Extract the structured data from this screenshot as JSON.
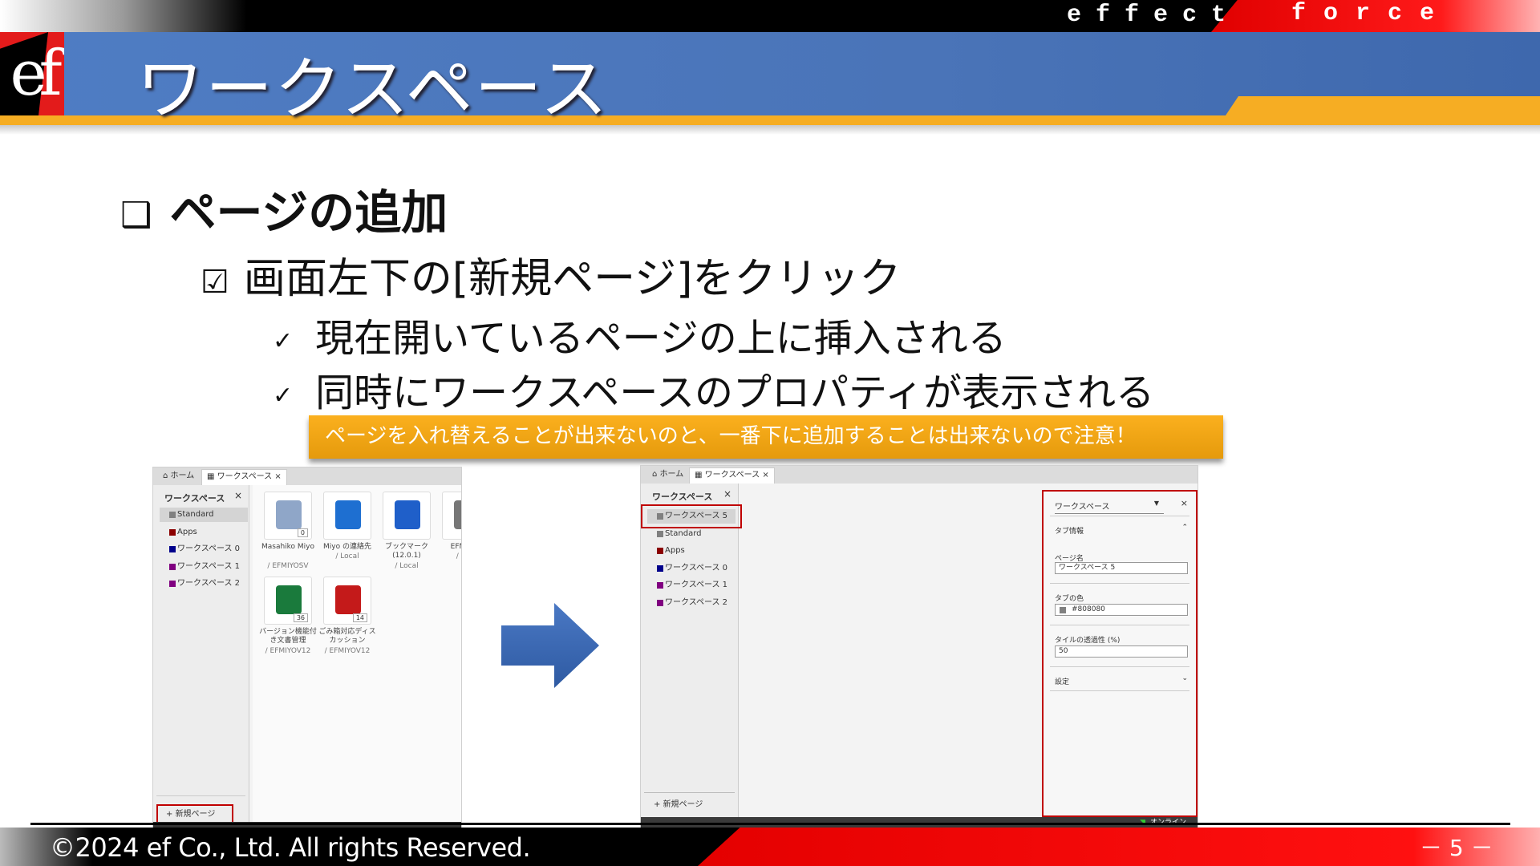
{
  "brand": {
    "left": "effect",
    "right": "force",
    "logo": "ef"
  },
  "slide": {
    "title": "ワークスペース",
    "heading": "ページの追加",
    "heading_marker": "❑",
    "step": "画面左下の[新規ページ]をクリック",
    "step_marker": "☑",
    "bullets": [
      "現在開いているページの上に挿入される",
      "同時にワークスペースのプロパティが表示される"
    ],
    "bullet_marker": "✓",
    "callout": "ページを入れ替えることが出来ないのと、一番下に追加することは出来ないので注意！"
  },
  "left_shot": {
    "tabs": [
      "ホーム",
      "ワークスペース"
    ],
    "panel_title": "ワークスペース",
    "items": [
      {
        "label": "Standard",
        "color": "#808080"
      },
      {
        "label": "Apps",
        "color": "#8b0000"
      },
      {
        "label": "ワークスペース 0",
        "color": "#00008b"
      },
      {
        "label": "ワークスペース 1",
        "color": "#800080"
      },
      {
        "label": "ワークスペース 2",
        "color": "#800080"
      }
    ],
    "tiles": [
      {
        "name": "Masahiko Miyo",
        "sub": "/ EFMIYOSV",
        "badge": "0",
        "color": "#8fa6c8"
      },
      {
        "name": "Miyo の連絡先",
        "sub": "/ Local",
        "badge": "",
        "color": "#1e6fd1"
      },
      {
        "name": "ブックマーク (12.0.1)",
        "sub": "/ Local",
        "badge": "",
        "color": "#1f5fc9"
      },
      {
        "name": "EFMIY レ",
        "sub": "/ EFM",
        "badge": "",
        "color": "#777777"
      },
      {
        "name": "バージョン機能付き文書管理",
        "sub": "/ EFMIYOV12",
        "badge": "36",
        "color": "#1a7a3c"
      },
      {
        "name": "ごみ箱対応ディスカッション",
        "sub": "/ EFMIYOV12",
        "badge": "14",
        "color": "#c41a1a"
      }
    ],
    "new_page": "新規ページ"
  },
  "right_shot": {
    "tabs": [
      "ホーム",
      "ワークスペース"
    ],
    "panel_title": "ワークスペース",
    "items": [
      {
        "label": "ワークスペース 5",
        "color": "#808080"
      },
      {
        "label": "Standard",
        "color": "#808080"
      },
      {
        "label": "Apps",
        "color": "#8b0000"
      },
      {
        "label": "ワークスペース 0",
        "color": "#00008b"
      },
      {
        "label": "ワークスペース 1",
        "color": "#800080"
      },
      {
        "label": "ワークスペース 2",
        "color": "#800080"
      }
    ],
    "new_page": "新規ページ",
    "props": {
      "selector": "ワークスペース",
      "section_tab": "タブ情報",
      "page_name_label": "ページ名",
      "page_name": "ワークスペース 5",
      "tab_color_label": "タブの色",
      "tab_color": "#808080",
      "opacity_label": "タイルの透過性 (%)",
      "opacity": "50",
      "settings": "設定"
    },
    "status": "オンライン"
  },
  "footer": {
    "copyright": "©2024 ef Co., Ltd.  All rights Reserved.",
    "page": "－ 5 －"
  }
}
